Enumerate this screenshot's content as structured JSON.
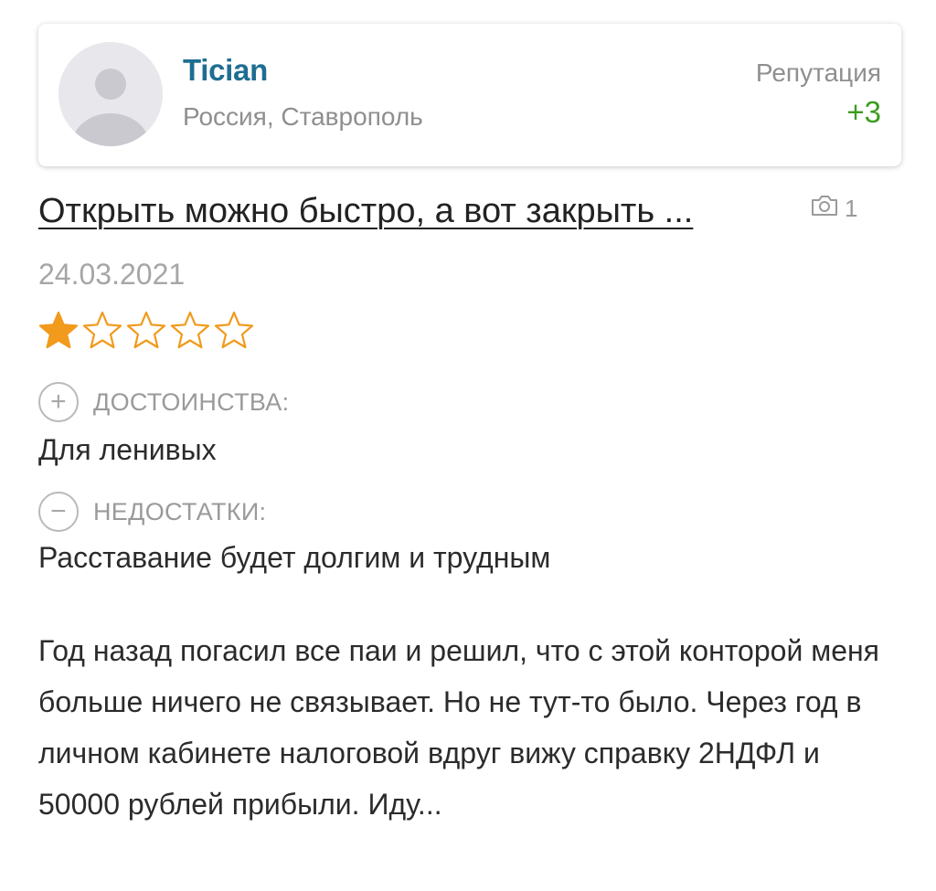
{
  "user": {
    "name": "Tician",
    "location": "Россия, Ставрополь",
    "reputation_label": "Репутация",
    "reputation_value": "+3"
  },
  "review": {
    "title": "Открыть можно быстро, а вот закрыть ...",
    "photo_count": "1",
    "date": "24.03.2021",
    "rating": 1,
    "rating_max": 5,
    "pros_label": "ДОСТОИНСТВА:",
    "pros_text": "Для ленивых",
    "cons_label": "НЕДОСТАТКИ:",
    "cons_text": "Расставание будет долгим и трудным",
    "body": "Год назад погасил все паи и решил, что с этой конторой меня больше ничего не связывает. Но не тут-то было. Через год в личном кабинете налоговой вдруг вижу справку 2НДФЛ и 50000 рублей прибыли. Иду..."
  },
  "icons": {
    "avatar": "user-avatar-placeholder-icon",
    "photo": "camera-icon",
    "star": "star-icon",
    "plus": "plus-circle-icon",
    "minus": "minus-circle-icon"
  },
  "colors": {
    "username": "#1f6e91",
    "reputation_positive": "#3a9c1f",
    "star_filled": "#f29a1b",
    "muted": "#9a9a9a"
  }
}
